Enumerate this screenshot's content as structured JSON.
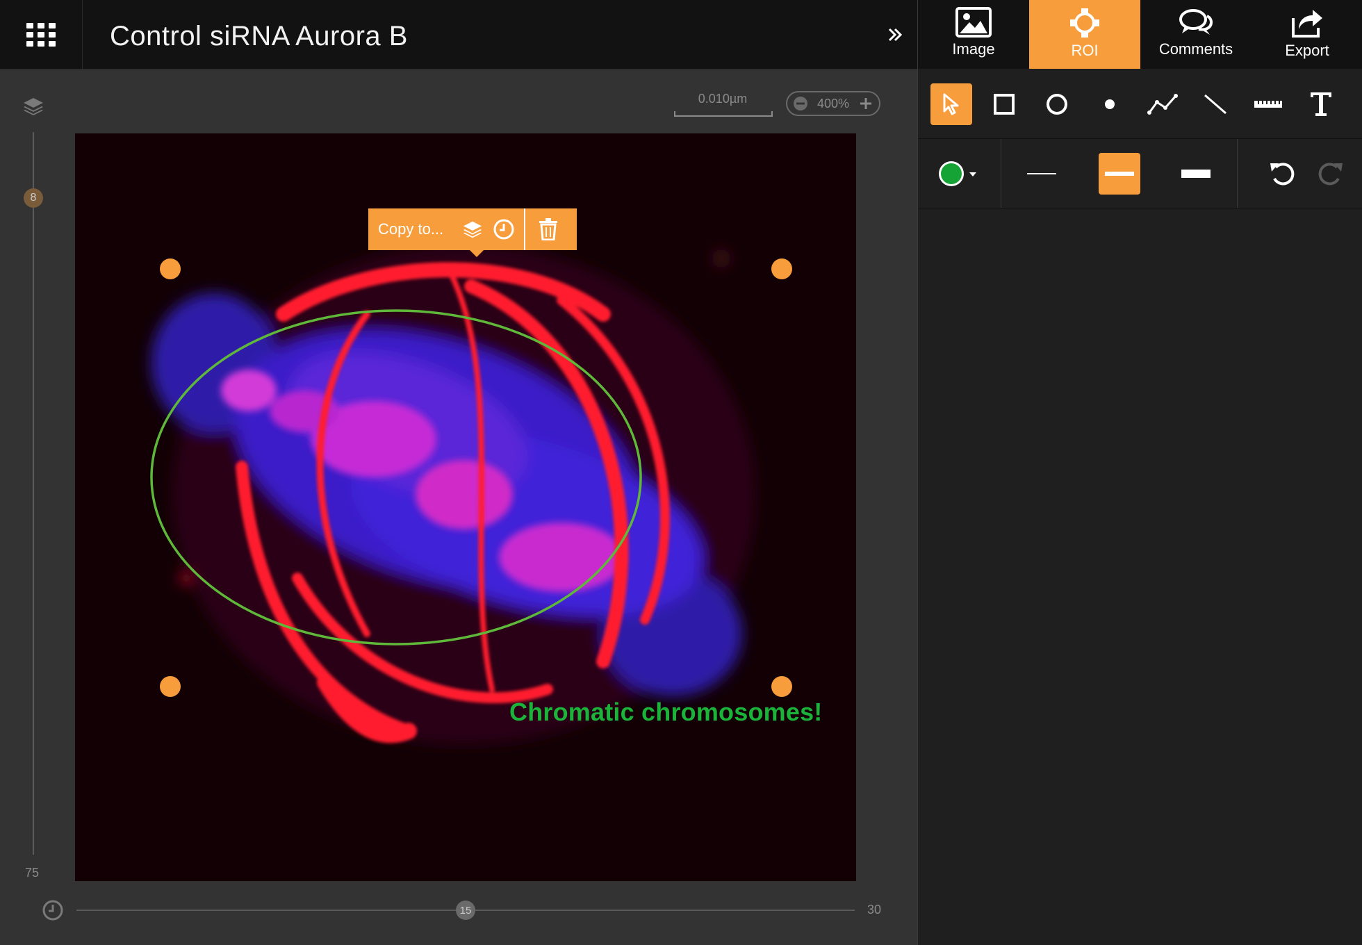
{
  "header": {
    "title": "Control siRNA Aurora B"
  },
  "tabs": [
    {
      "label": "Image",
      "icon": "image-icon",
      "active": false
    },
    {
      "label": "ROI",
      "icon": "roi-icon",
      "active": true
    },
    {
      "label": "Comments",
      "icon": "comments-icon",
      "active": false
    },
    {
      "label": "Export",
      "icon": "export-icon",
      "active": false
    }
  ],
  "viewer": {
    "scale_label": "0.010µm",
    "zoom_label": "400%",
    "z_position": "8",
    "z_max": "75",
    "t_position": "15",
    "t_max": "30"
  },
  "popup": {
    "copy_label": "Copy to..."
  },
  "roi": {
    "shape": "ellipse",
    "stroke_color": "#5fb83a",
    "text_label": "Chromatic chromosomes!",
    "text_color": "#1bb33a"
  },
  "style": {
    "selected_color": "#16a335",
    "selected_line_width": "medium"
  },
  "colors": {
    "accent": "#f89d3c",
    "panel_bg": "#1f1f1f",
    "topbar_bg": "#121212"
  }
}
